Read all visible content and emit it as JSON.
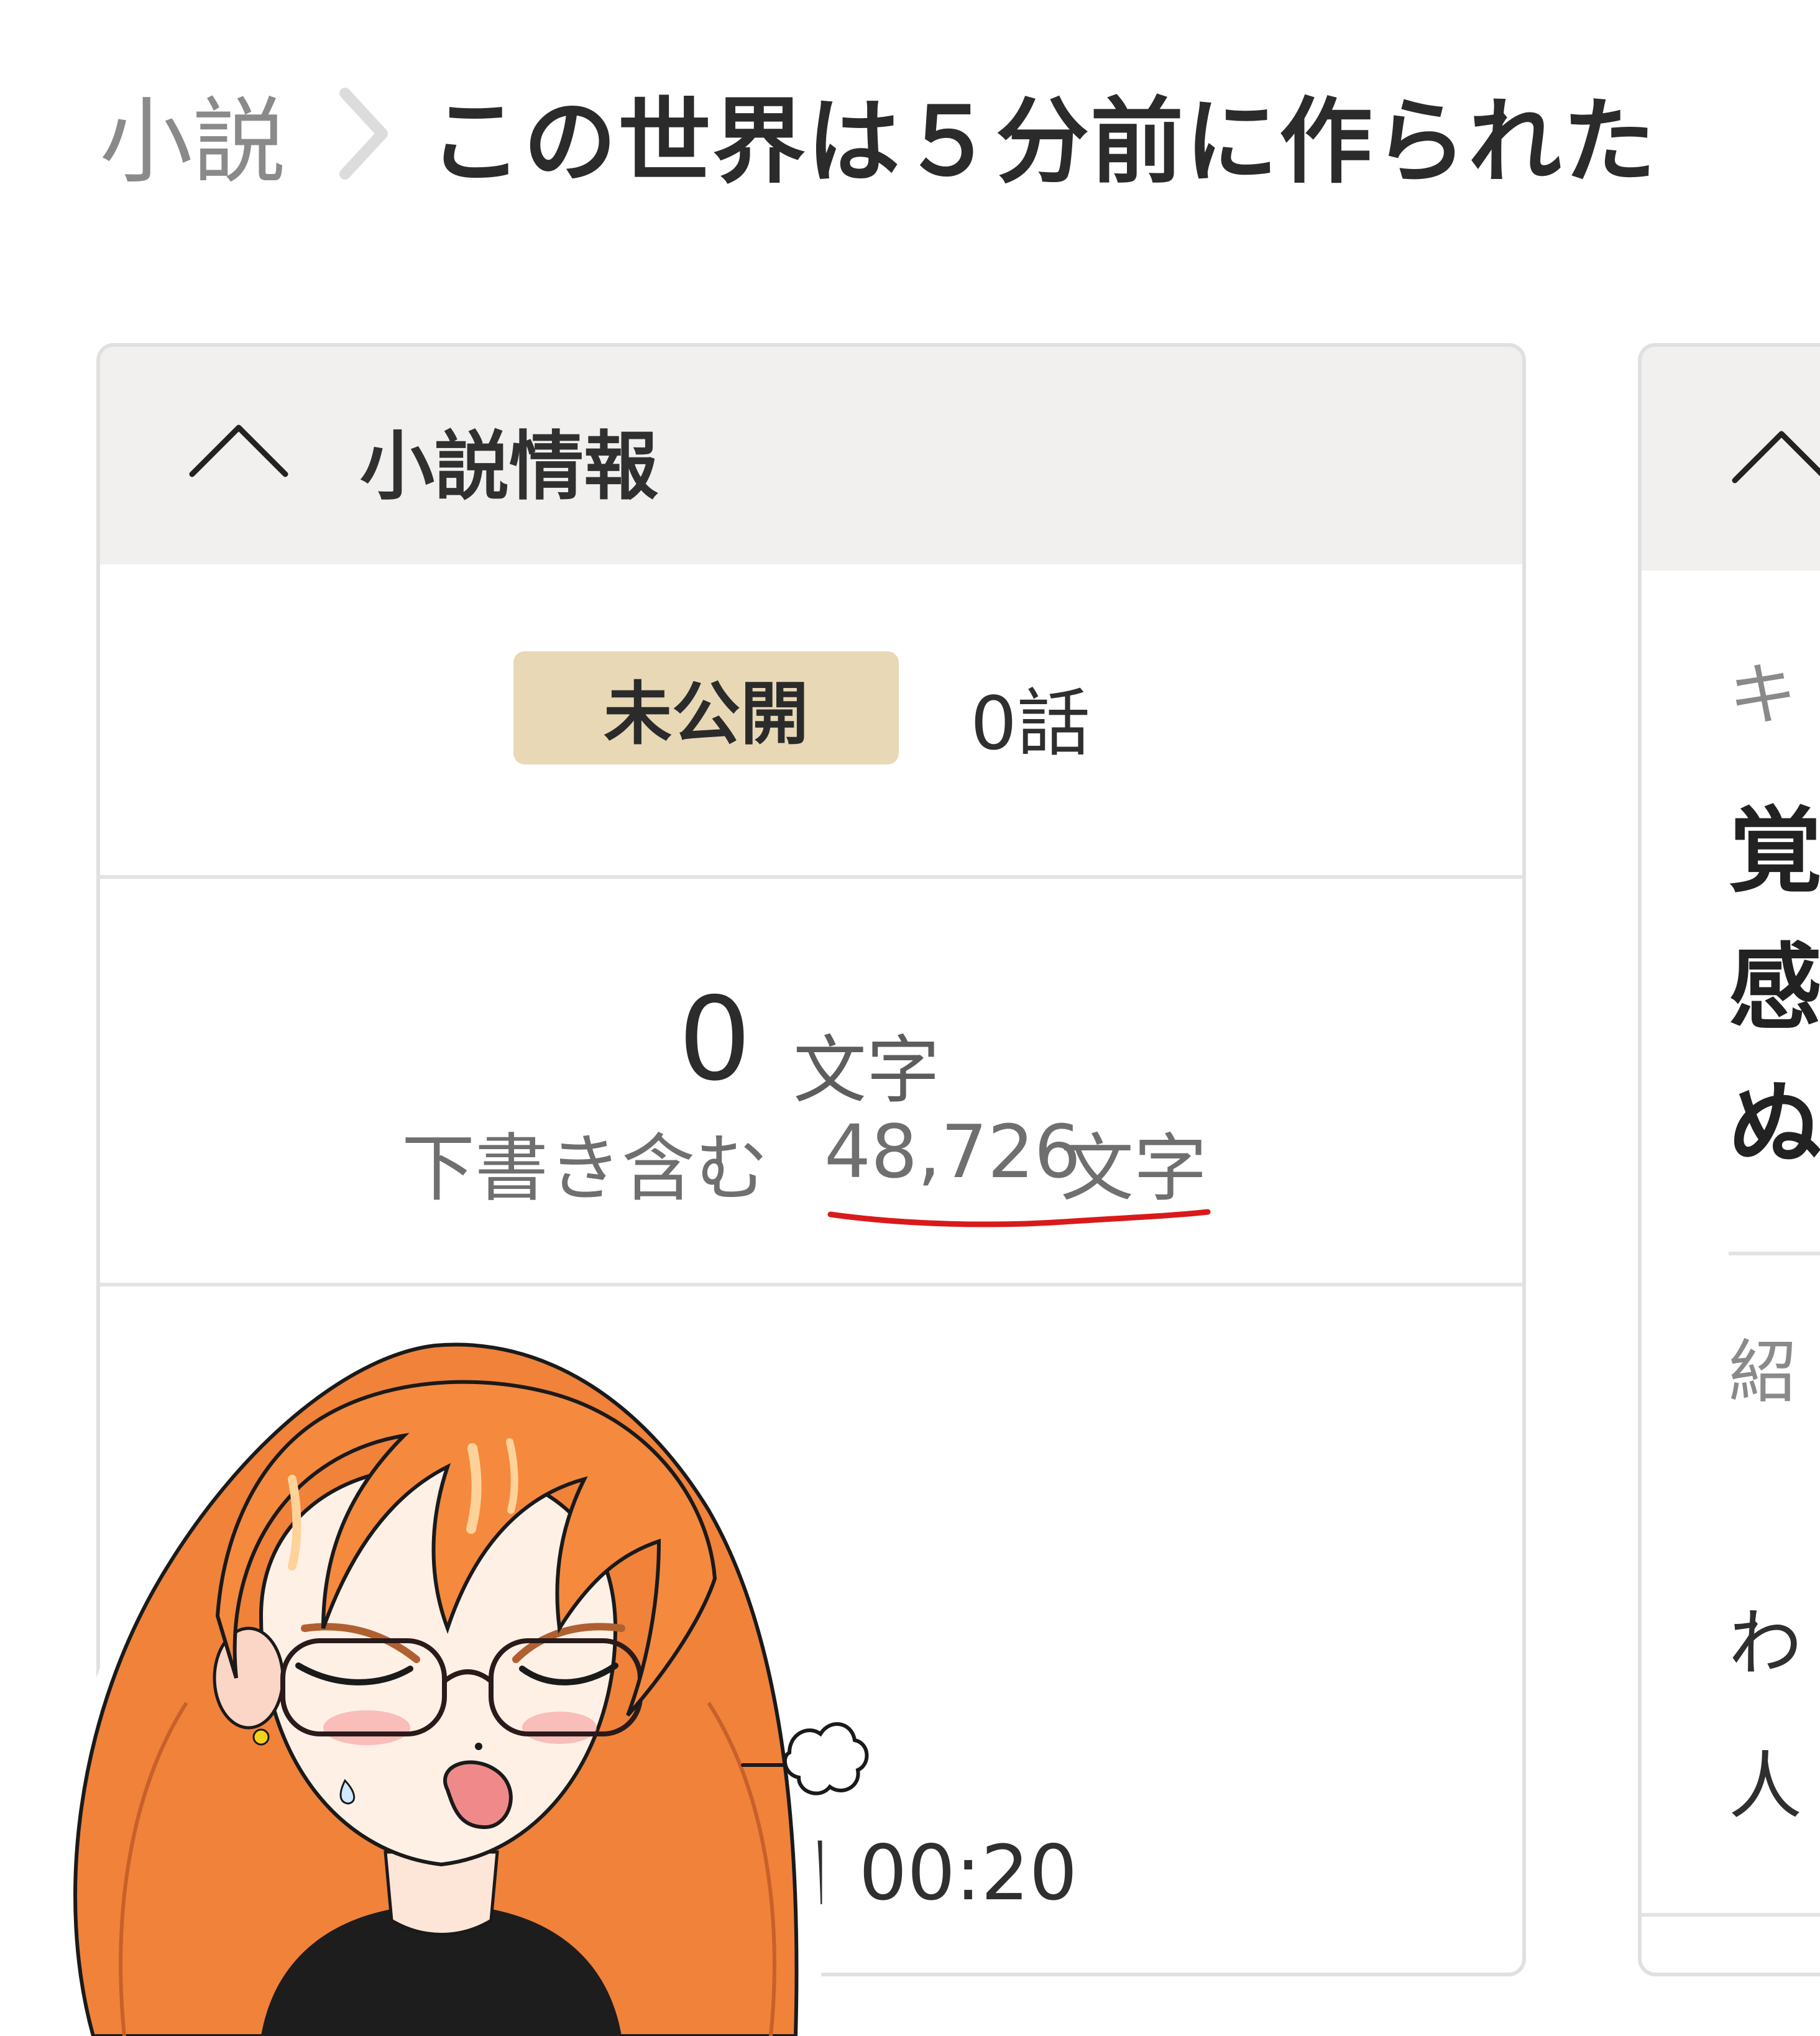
{
  "breadcrumb": {
    "root": "小説",
    "title": "この世界は５分前に作られた"
  },
  "info_panel": {
    "title": "小説情報",
    "status_badge": "未公開",
    "episodes": "0話",
    "char_count": "0",
    "char_unit": "文字",
    "draft_label": "下書き含む",
    "draft_count": "48,726",
    "draft_unit": "文字",
    "date_partial": "日 00:20"
  },
  "side_panel": {
    "label_1": "キ",
    "line_1": "覚",
    "line_2": "感",
    "line_3": "ぬ",
    "label_2": "紹",
    "body_1": "",
    "body_2": "わ",
    "body_3": "人"
  },
  "colors": {
    "badge_bg": "#e8d8b6",
    "header_bg": "#f1f0ee",
    "underline": "#d91a1a",
    "hair": "#f0823a"
  },
  "icons": {
    "breadcrumb_separator": "chevron-right-icon",
    "collapse": "chevron-up-icon"
  }
}
